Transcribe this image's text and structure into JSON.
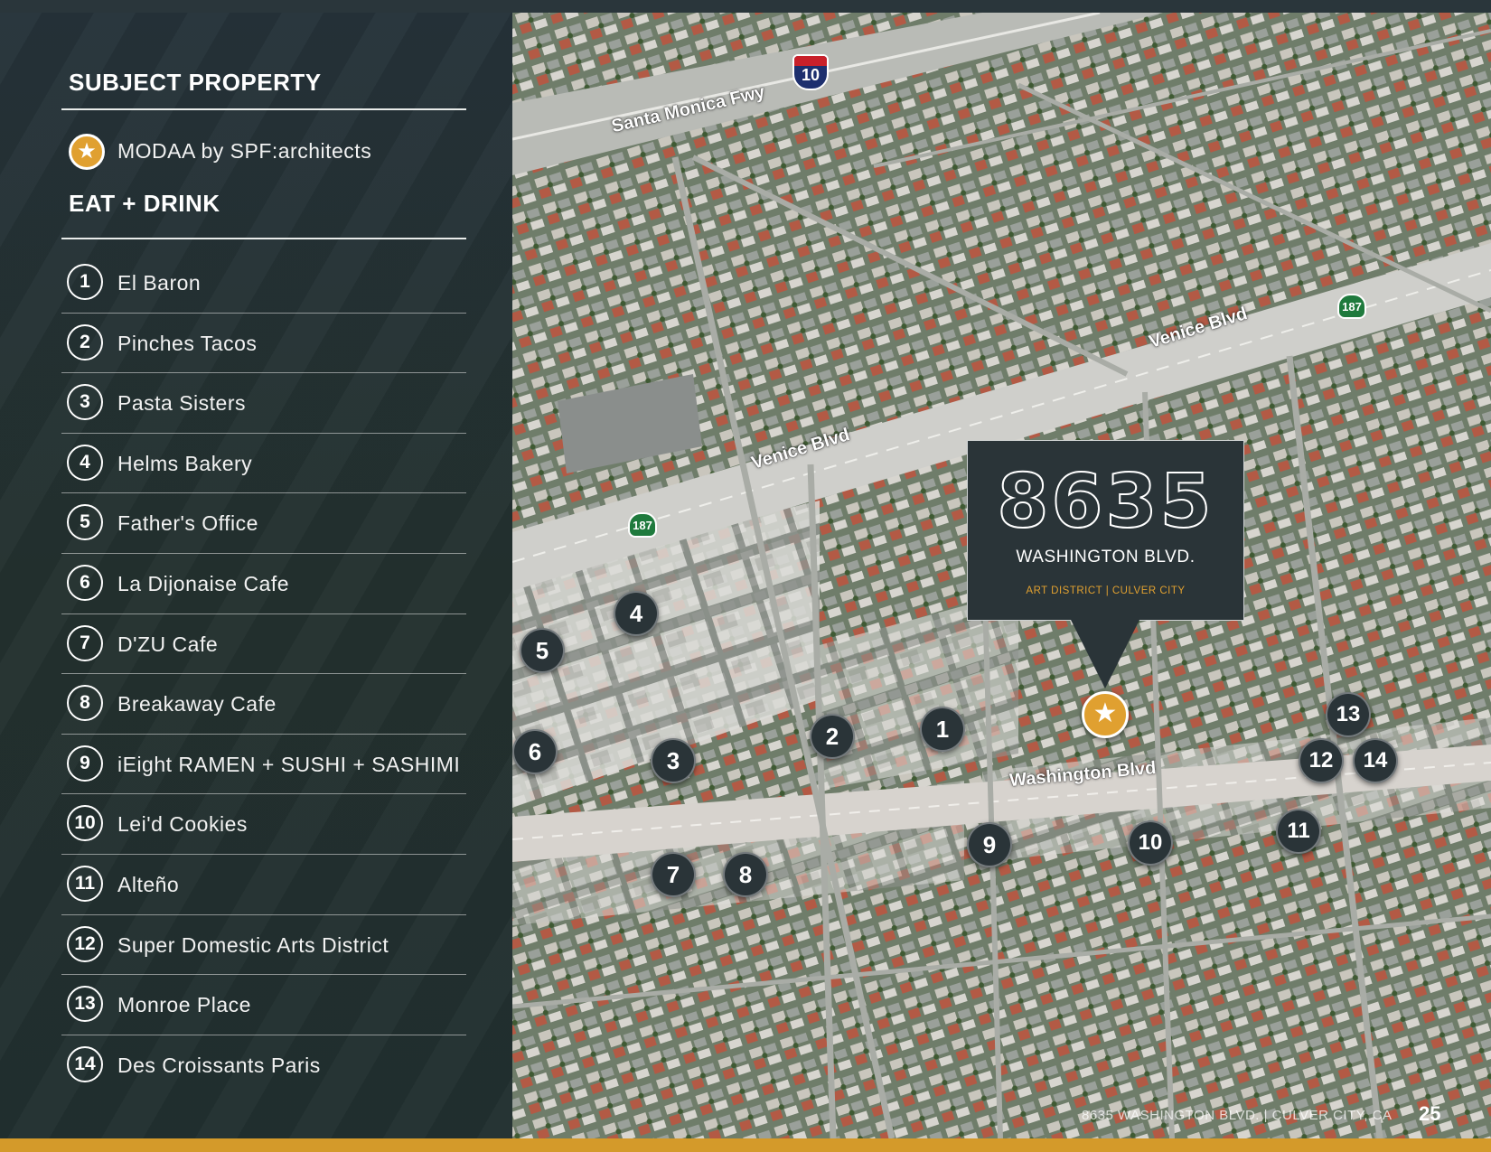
{
  "subject": {
    "heading": "SUBJECT PROPERTY",
    "name": "MODAA by SPF:architects",
    "star": "★"
  },
  "eat_drink": {
    "heading": "EAT + DRINK",
    "items": [
      {
        "num": "1",
        "label": "El Baron"
      },
      {
        "num": "2",
        "label": "Pinches Tacos"
      },
      {
        "num": "3",
        "label": "Pasta Sisters"
      },
      {
        "num": "4",
        "label": "Helms Bakery"
      },
      {
        "num": "5",
        "label": "Father's Office"
      },
      {
        "num": "6",
        "label": "La Dijonaise Cafe"
      },
      {
        "num": "7",
        "label": "D'ZU Cafe"
      },
      {
        "num": "8",
        "label": "Breakaway Cafe"
      },
      {
        "num": "9",
        "label": "iEight RAMEN + SUSHI + SASHIMI"
      },
      {
        "num": "10",
        "label": "Lei'd Cookies"
      },
      {
        "num": "11",
        "label": "Alteño"
      },
      {
        "num": "12",
        "label": "Super Domestic Arts District"
      },
      {
        "num": "13",
        "label": "Monroe Place"
      },
      {
        "num": "14",
        "label": "Des Croissants Paris"
      }
    ]
  },
  "callout": {
    "number": "8635",
    "street": "WASHINGTON BLVD.",
    "district": "ART DISTRICT | CULVER CITY"
  },
  "roads": {
    "freeway": "Santa Monica Fwy",
    "venice_upper": "Venice Blvd",
    "venice_lower": "Venice Blvd",
    "washington": "Washington Blvd",
    "interstate": "10",
    "state_route_a": "187",
    "state_route_b": "187"
  },
  "footer": {
    "text": "8635 WASHINGTON BLVD. | CULVER CITY, CA",
    "page": "25"
  },
  "colors": {
    "accent": "#e0a030",
    "panel": "#2a3438",
    "gold_bar": "#d49a2a"
  }
}
